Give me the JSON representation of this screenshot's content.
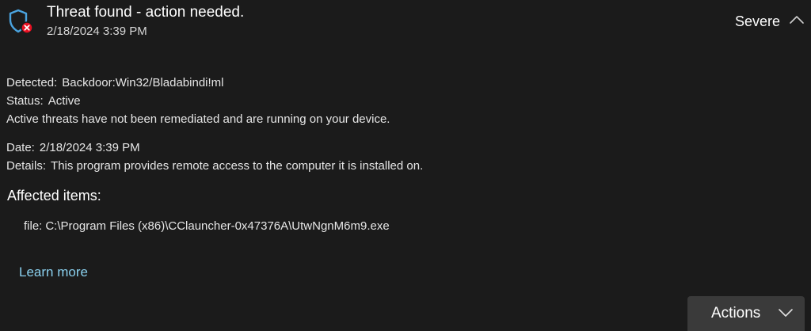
{
  "header": {
    "title": "Threat found - action needed.",
    "timestamp": "2/18/2024 3:39 PM",
    "severity": "Severe",
    "status_icon": "shield-error-icon",
    "toggle_icon": "chevron-up-icon"
  },
  "details": {
    "detected_label": "Detected:",
    "detected_value": "Backdoor:Win32/Bladabindi!ml",
    "status_label": "Status:",
    "status_value": "Active",
    "status_note": "Active threats have not been remediated and are running on your device.",
    "date_label": "Date:",
    "date_value": "2/18/2024 3:39 PM",
    "details_label": "Details:",
    "details_value": "This program provides remote access to the computer it is installed on."
  },
  "affected": {
    "heading": "Affected items:",
    "items": [
      {
        "type_label": "file:",
        "path": "C:\\Program Files (x86)\\CClauncher-0x47376A\\UtwNgnM6m9.exe"
      }
    ]
  },
  "links": {
    "learn_more": "Learn more"
  },
  "actions": {
    "label": "Actions",
    "icon": "chevron-down-icon"
  },
  "colors": {
    "background": "#1b1b1b",
    "shield_blue": "#4aa3df",
    "error_red": "#e81123",
    "link": "#8ad0ee",
    "button": "#3a3a3a"
  }
}
